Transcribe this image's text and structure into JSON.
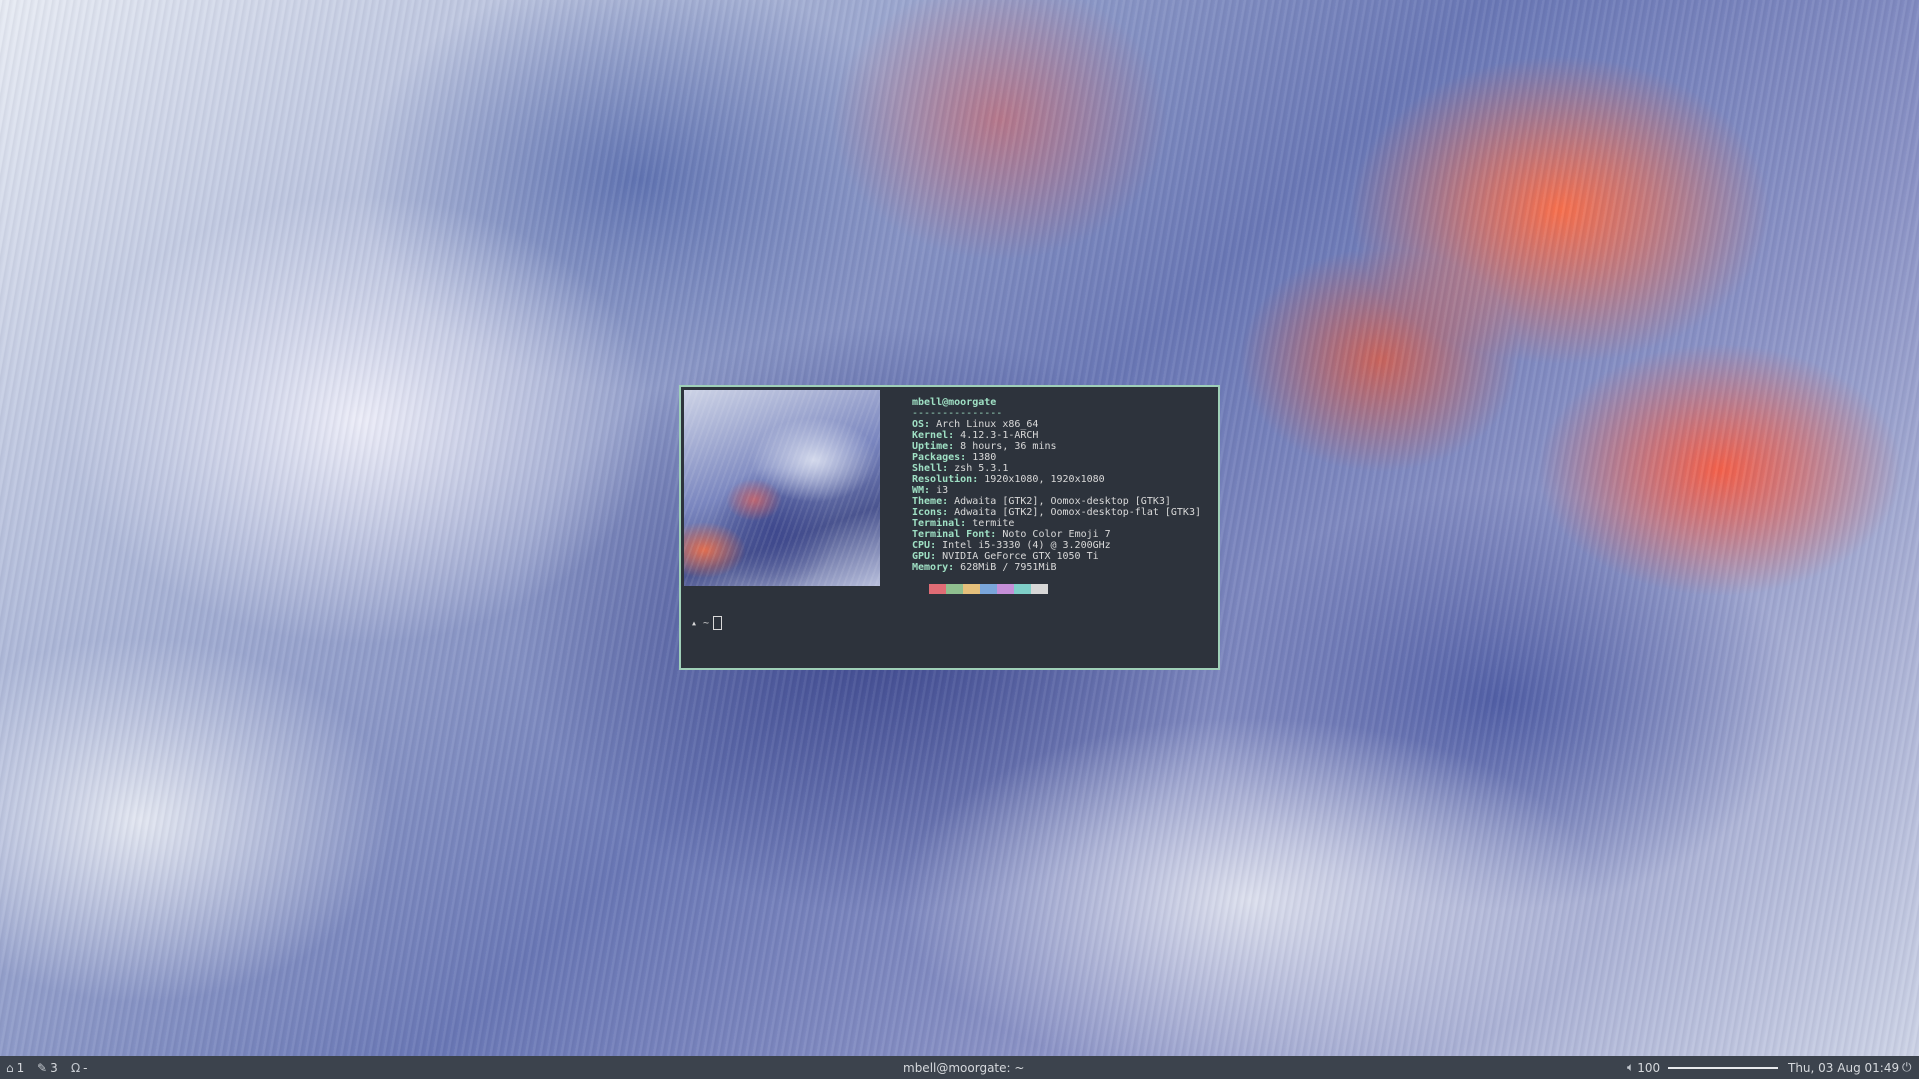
{
  "desktop": {
    "wallpaper": "abstract swirl of blue, white and orange"
  },
  "terminal": {
    "user_host": "mbell@moorgate",
    "separator": "---------------",
    "info": [
      {
        "key": "OS",
        "value": "Arch Linux x86_64"
      },
      {
        "key": "Kernel",
        "value": "4.12.3-1-ARCH"
      },
      {
        "key": "Uptime",
        "value": "8 hours, 36 mins"
      },
      {
        "key": "Packages",
        "value": "1380"
      },
      {
        "key": "Shell",
        "value": "zsh 5.3.1"
      },
      {
        "key": "Resolution",
        "value": "1920x1080, 1920x1080"
      },
      {
        "key": "WM",
        "value": "i3"
      },
      {
        "key": "Theme",
        "value": "Adwaita [GTK2], Oomox-desktop [GTK3]"
      },
      {
        "key": "Icons",
        "value": "Adwaita [GTK2], Oomox-desktop-flat [GTK3]"
      },
      {
        "key": "Terminal",
        "value": "termite"
      },
      {
        "key": "Terminal Font",
        "value": "Noto Color Emoji 7"
      },
      {
        "key": "CPU",
        "value": "Intel i5-3330 (4) @ 3.200GHz"
      },
      {
        "key": "GPU",
        "value": "NVIDIA GeForce GTX 1050 Ti"
      },
      {
        "key": "Memory",
        "value": "628MiB / 7951MiB"
      }
    ],
    "palette": [
      "#2d333c",
      "#e06c75",
      "#8fbf8f",
      "#e5c07b",
      "#7aa6da",
      "#c58fd8",
      "#7fcfc8",
      "#d7d7d7"
    ],
    "prompt": "▴ ~",
    "border_color": "#9fd0b8",
    "bg_color": "#2d333c"
  },
  "panel": {
    "workspaces": [
      {
        "icon": "home-icon",
        "label": "1"
      },
      {
        "icon": "pencil-icon",
        "label": "3"
      },
      {
        "icon": "headphones-icon",
        "label": "-"
      }
    ],
    "window_title": "mbell@moorgate: ~",
    "volume_label": "100",
    "volume_level": 1.0,
    "clock": "Thu, 03 Aug 01:49",
    "bg_color": "#3c434d"
  }
}
